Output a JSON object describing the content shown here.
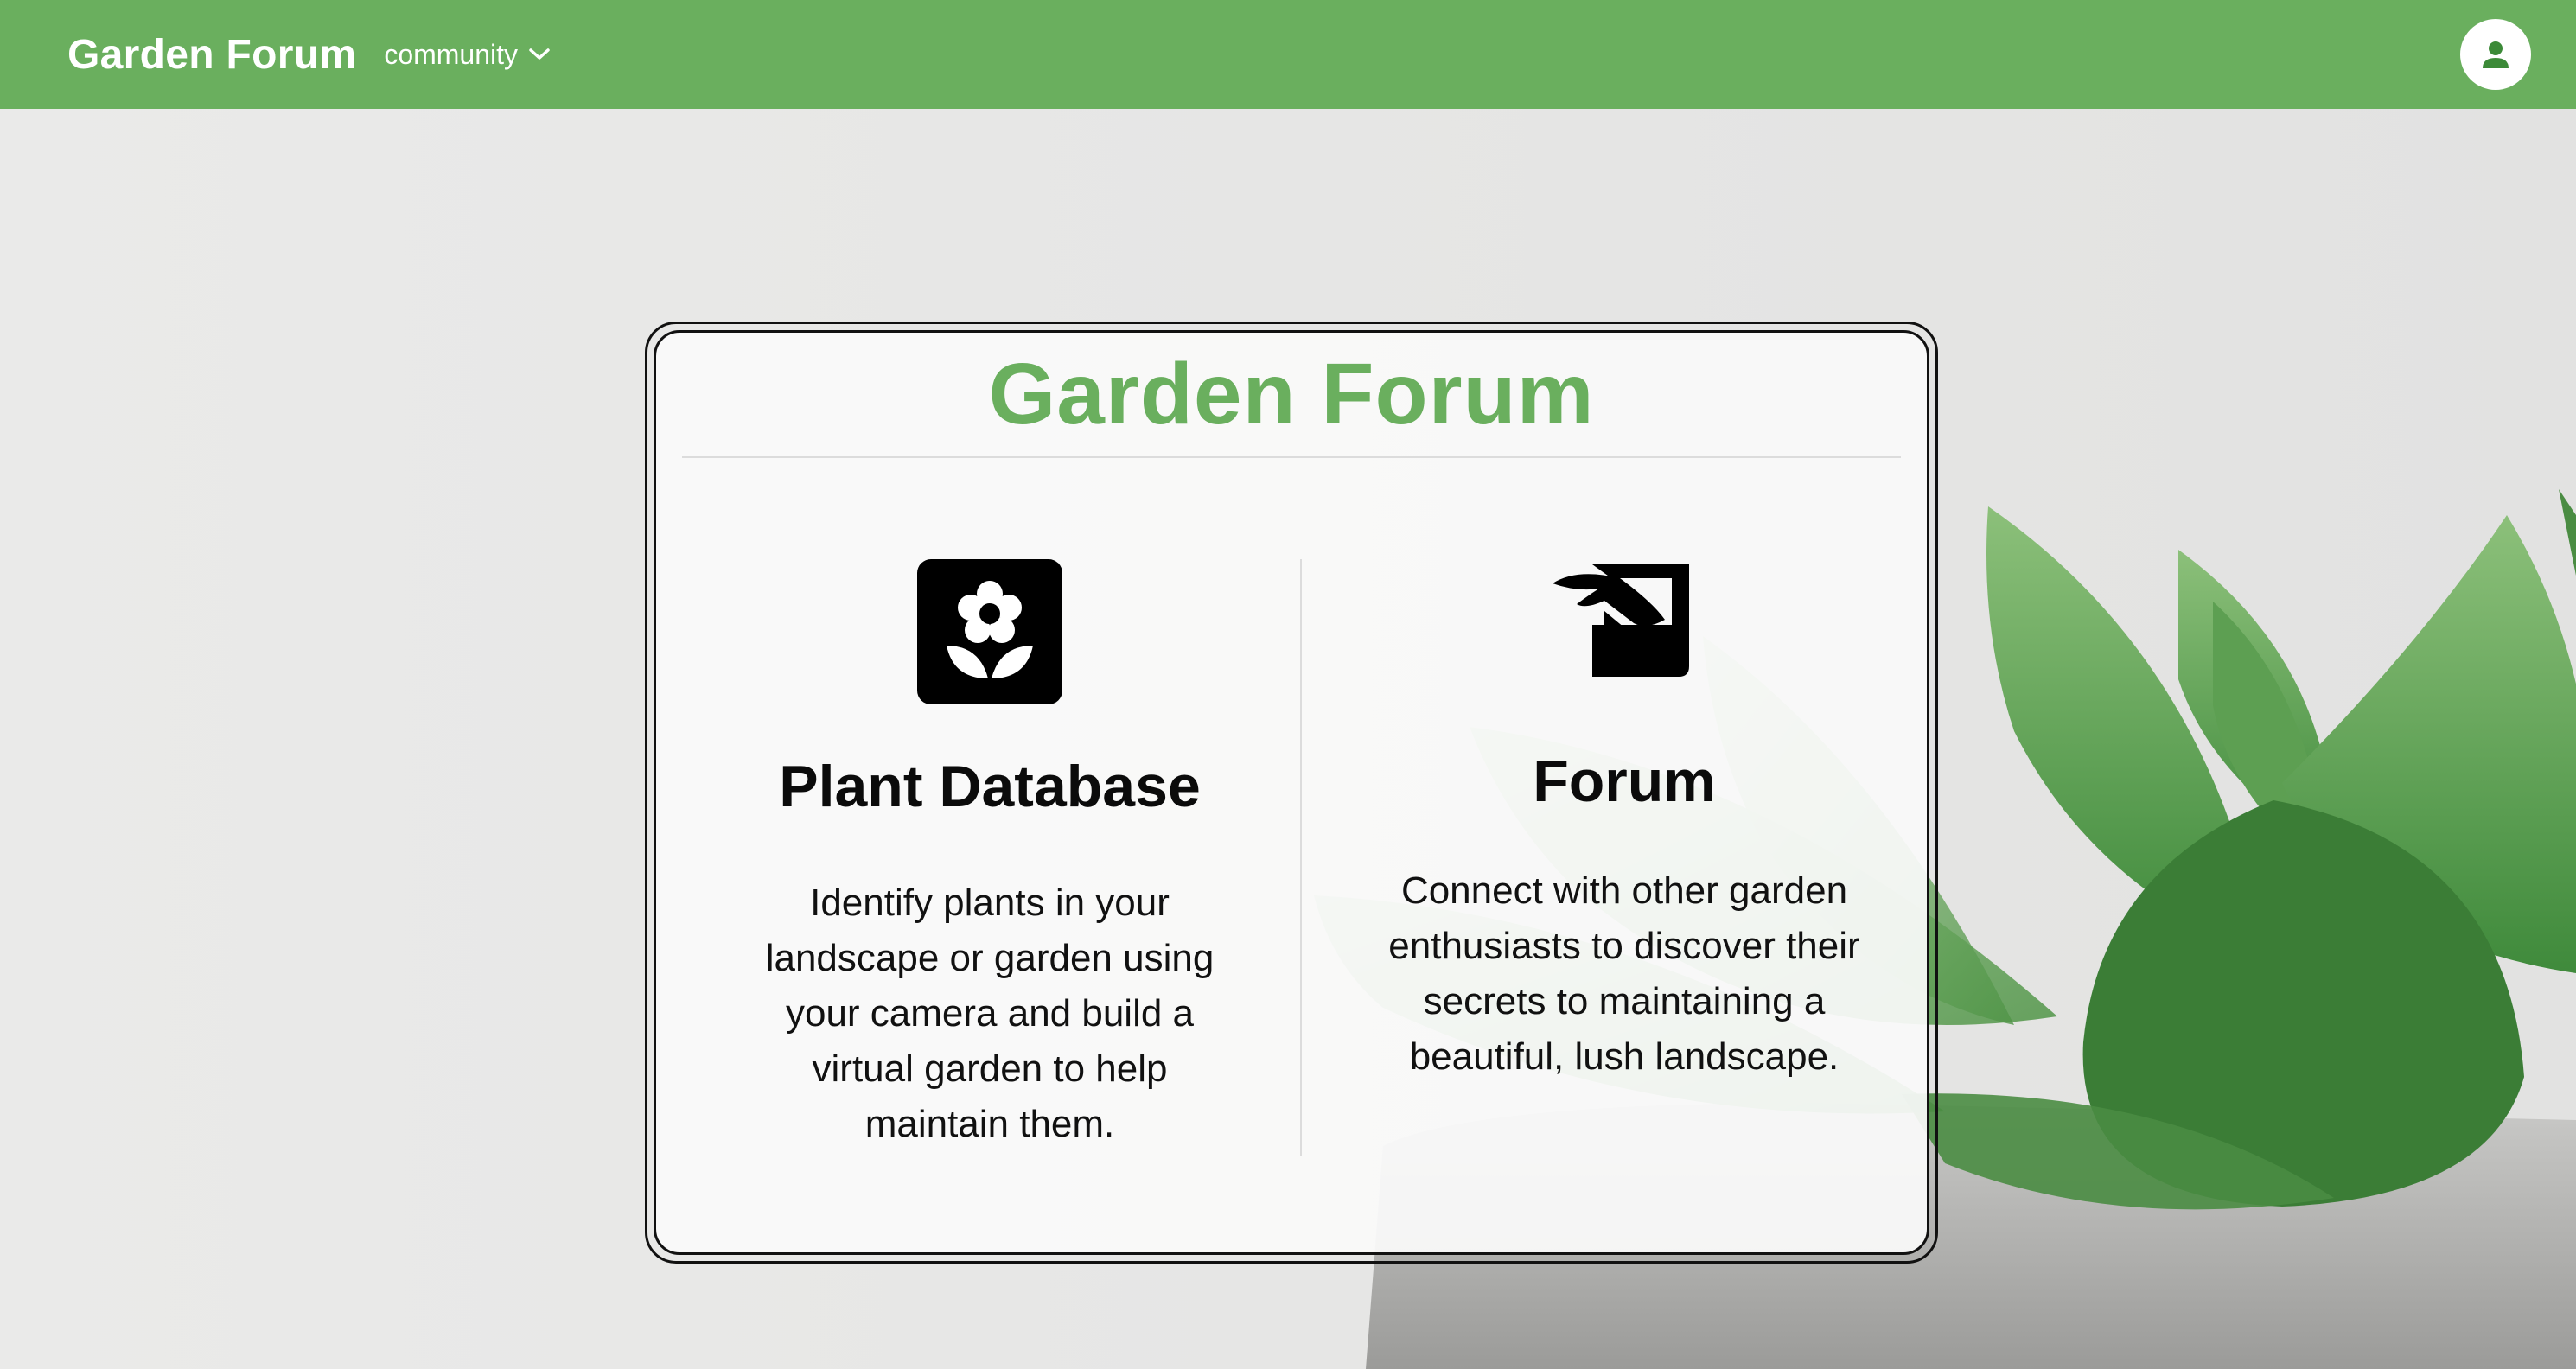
{
  "header": {
    "brand": "Garden Forum",
    "nav_label": "community"
  },
  "card": {
    "title": "Garden Forum",
    "features": [
      {
        "heading": "Plant Database",
        "description": "Identify plants in your landscape or garden using your camera and build a virtual garden to help maintain them."
      },
      {
        "heading": "Forum",
        "description": "Connect with other garden enthusiasts to discover their secrets to maintaining a beautiful, lush landscape."
      }
    ]
  },
  "icons": {
    "nav": "chevron-down-icon",
    "avatar": "person-icon",
    "plant_database": "flower-icon",
    "forum": "sign-post-icon"
  },
  "colors": {
    "brand_green": "#6aaf5e",
    "background": "#ebebea",
    "card_background": "#fafafa",
    "text": "#111111"
  }
}
